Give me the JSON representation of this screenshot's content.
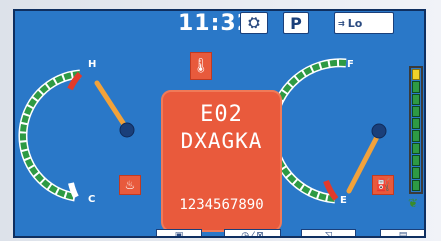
{
  "header": {
    "time": "11:32",
    "engine_icon": "engine-icon",
    "p_label": "P",
    "lo_label": "Lo",
    "lo_icon": "rabbit-icon"
  },
  "warning": {
    "code": "E02",
    "text": "DXAGKA",
    "serial": "1234567890",
    "icon": "hydraulic-oil-icon"
  },
  "temp_gauge": {
    "high_label": "H",
    "low_label": "C",
    "icon": "coolant-temp-icon",
    "level": 0.75
  },
  "fuel_gauge": {
    "full_label": "F",
    "empty_label": "E",
    "icon": "fuel-pump-icon",
    "level": 0.3
  },
  "eco_bar": {
    "segments": 10,
    "filled": 10,
    "icon": "leaf-icon"
  },
  "tabs": [
    {
      "name": "camera",
      "icon": "camera-icon"
    },
    {
      "name": "maintenance",
      "icon": "clock-filter-icon"
    },
    {
      "name": "wiper",
      "icon": "wiper-icon"
    },
    {
      "name": "menu",
      "icon": "document-icon"
    }
  ],
  "colors": {
    "screen_bg": "#2a78c8",
    "warning_bg": "#e95a3c",
    "gauge_green": "#2e9a44",
    "gauge_red": "#e23a2a",
    "needle": "#f2a23a"
  }
}
